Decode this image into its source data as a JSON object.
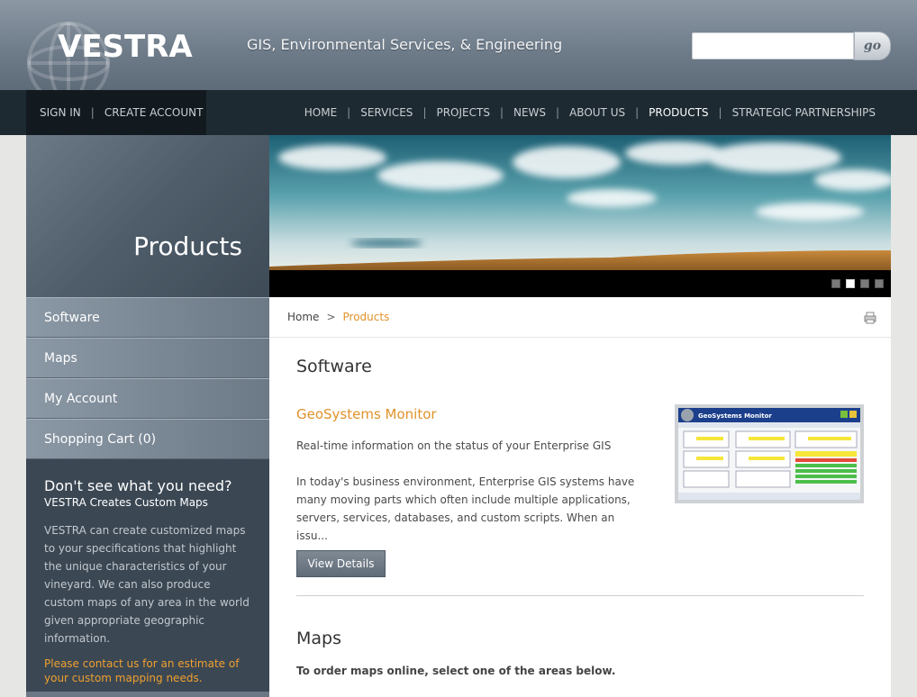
{
  "header": {
    "logo": "VESTRA",
    "tagline": "GIS, Environmental Services, & Engineering",
    "search": {
      "placeholder": "",
      "go_label": "go"
    }
  },
  "account_nav": {
    "sign_in": "SIGN IN",
    "separator": "|",
    "create_account": "CREATE ACCOUNT"
  },
  "main_nav": {
    "items": [
      "HOME",
      "SERVICES",
      "PROJECTS",
      "NEWS",
      "ABOUT US",
      "PRODUCTS",
      "STRATEGIC PARTNERSHIPS"
    ],
    "active": "PRODUCTS",
    "separator": "|"
  },
  "sidebar": {
    "title": "Products",
    "menu": [
      "Software",
      "Maps",
      "My Account",
      "Shopping Cart (0)"
    ],
    "promo": {
      "heading": "Don't see what you need?",
      "subheading": "VESTRA Creates Custom Maps",
      "body": "VESTRA can create customized maps to your specifications that highlight the unique characteristics of your vineyard. We can also produce custom maps of any area in the world given appropriate geographic information.",
      "cta": "Please contact us for an estimate of your custom mapping needs."
    }
  },
  "banner": {
    "slides": 4,
    "active_slide": 2
  },
  "breadcrumb": {
    "home": "Home",
    "separator": ">",
    "current": "Products"
  },
  "content": {
    "software": {
      "heading": "Software",
      "product_title": "GeoSystems Monitor",
      "summary": "Real-time information on the status of your Enterprise GIS",
      "description": "In today's business environment, Enterprise GIS systems have many moving parts which often include multiple applications, servers, services, databases, and custom scripts. When an issu...",
      "button": "View Details",
      "thumbnail_title": "GeoSystems Monitor"
    },
    "maps": {
      "heading": "Maps",
      "instruction": "To order maps online, select one of the areas below."
    }
  },
  "colors": {
    "accent": "#e0922a",
    "nav_bg": "#1e2a31",
    "sidebar_promo_bg": "#3b4753",
    "header_gradient_top": "#8c98a4"
  },
  "icons": [
    "globe-logo-icon",
    "print-icon"
  ]
}
